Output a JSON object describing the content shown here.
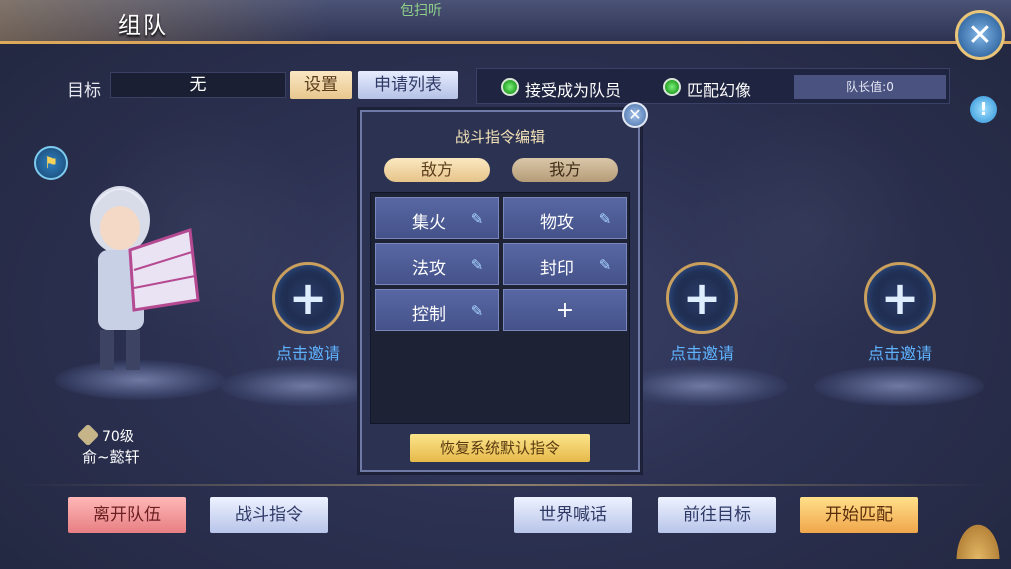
{
  "header": {
    "title": "组队",
    "top_text": "包扫听"
  },
  "target_row": {
    "label": "目标",
    "value": "无",
    "settings_btn": "设置",
    "apply_list_btn": "申请列表"
  },
  "options": {
    "accept_member": "接受成为队员",
    "match_phantom": "匹配幻像",
    "leader_value": "队长值:0"
  },
  "member": {
    "level": "70级",
    "name": "俞~懿轩"
  },
  "invite_slots": [
    {
      "label": "点击邀请"
    },
    {
      "label": "点击邀请"
    },
    {
      "label": "点击邀请"
    }
  ],
  "dialog": {
    "title": "战斗指令编辑",
    "tabs": [
      "敌方",
      "我方"
    ],
    "commands": [
      "集火",
      "物攻",
      "法攻",
      "封印",
      "控制"
    ],
    "add_symbol": "+",
    "restore_btn": "恢复系统默认指令"
  },
  "bottom": {
    "leave": "离开队伍",
    "battle_cmd": "战斗指令",
    "world_shout": "世界喊话",
    "goto_target": "前往目标",
    "start_match": "开始匹配"
  },
  "icons": {
    "close": "close-icon",
    "info": "info-icon",
    "flag": "flag-icon",
    "edit": "pencil-icon",
    "plus": "plus-icon"
  },
  "colors": {
    "accent_gold": "#d8a35a",
    "invite_blue": "#5fb3ff",
    "radio_green": "#27a327"
  }
}
